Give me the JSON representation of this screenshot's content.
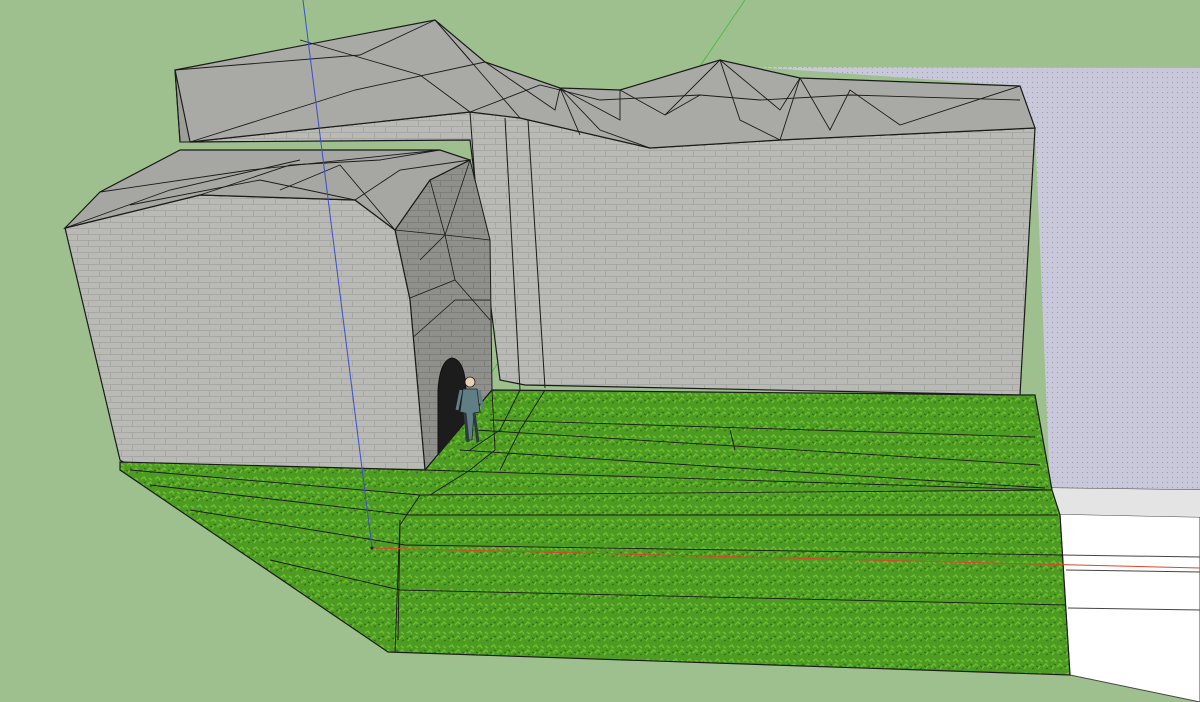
{
  "viewport": {
    "background": "#9ec08e"
  },
  "materials": {
    "stone": "#b9b9b5",
    "stone_shadow": "#8e8e8c",
    "stone_top": "#a6a6a3",
    "grass": "#4d9b22",
    "grass_dark": "#3d8419",
    "sky_panel": "#c9c9db",
    "white_panel": "#ffffff",
    "edge": "#1a1a1a",
    "axis_red": "#d9472b",
    "axis_blue": "#3a4fd0",
    "axis_green": "#4dbb4d"
  },
  "icons": {
    "person": "scale-figure-icon",
    "doorway": "cave-arch"
  }
}
